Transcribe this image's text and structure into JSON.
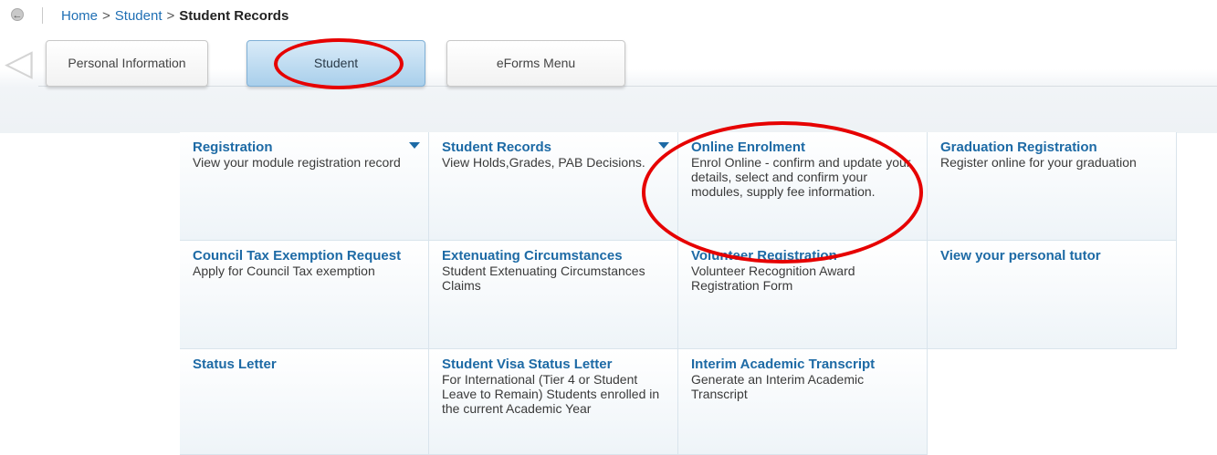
{
  "breadcrumb": {
    "home": "Home",
    "student": "Student",
    "separator": ">",
    "current": "Student Records"
  },
  "tabs": [
    {
      "label": "Personal Information",
      "active": false
    },
    {
      "label": "Student",
      "active": true
    },
    {
      "label": "eForms Menu",
      "active": false
    }
  ],
  "menu": [
    {
      "title": "Registration",
      "desc": "View your module registration record",
      "has_dropdown": true
    },
    {
      "title": "Student Records",
      "desc": "View Holds,Grades, PAB Decisions.",
      "has_dropdown": true
    },
    {
      "title": "Online Enrolment",
      "desc": "Enrol Online - confirm and update your details, select and confirm your modules, supply fee information.",
      "has_dropdown": false
    },
    {
      "title": "Graduation Registration",
      "desc": "Register online for your graduation",
      "has_dropdown": false
    },
    {
      "title": "Council Tax Exemption Request",
      "desc": "Apply for Council Tax exemption",
      "has_dropdown": false
    },
    {
      "title": "Extenuating Circumstances",
      "desc": "Student Extenuating Circumstances Claims",
      "has_dropdown": false
    },
    {
      "title": "Volunteer Registration",
      "desc": "Volunteer Recognition Award Registration Form",
      "has_dropdown": false
    },
    {
      "title": "View your personal tutor",
      "desc": "",
      "has_dropdown": false
    },
    {
      "title": "Status Letter",
      "desc": "",
      "has_dropdown": false
    },
    {
      "title": "Student Visa Status Letter",
      "desc": "For International (Tier 4 or Student Leave to Remain) Students enrolled in the current Academic Year",
      "has_dropdown": false
    },
    {
      "title": "Interim Academic Transcript",
      "desc": "Generate an Interim Academic Transcript",
      "has_dropdown": false
    }
  ],
  "colors": {
    "link": "#1d6aa5",
    "annotation": "#e60000",
    "active_tab": "#a9cfeb"
  }
}
